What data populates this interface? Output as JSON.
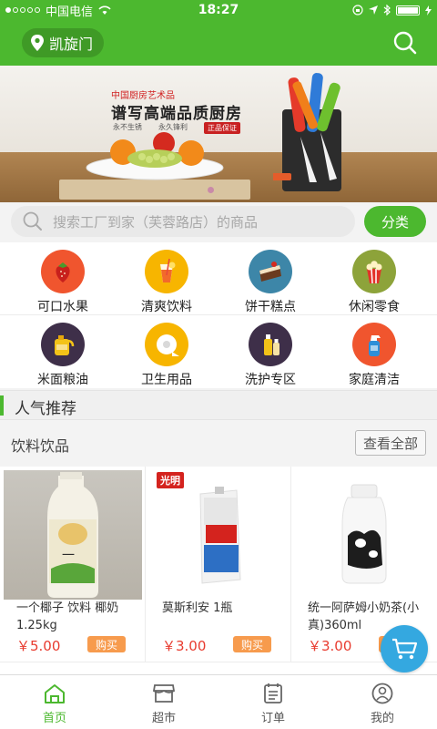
{
  "status_bar": {
    "carrier": "中国电信",
    "time": "18:27"
  },
  "header": {
    "location": "凯旋门"
  },
  "banner": {
    "subtitle": "中国厨房艺术品",
    "title": "谱写高端品质厨房",
    "tag1": "永不生锈",
    "tag2": "永久锋利",
    "badge": "正品保证"
  },
  "search": {
    "placeholder": "搜索工厂到家（芙蓉路店）的商品",
    "category_label": "分类"
  },
  "categories": [
    {
      "label": "可口水果",
      "color": "#f0552e",
      "icon": "strawberry-icon"
    },
    {
      "label": "清爽饮料",
      "color": "#f7b500",
      "icon": "drink-icon"
    },
    {
      "label": "饼干糕点",
      "color": "#3d86a8",
      "icon": "cake-icon"
    },
    {
      "label": "休闲零食",
      "color": "#8da33a",
      "icon": "popcorn-icon"
    },
    {
      "label": "米面粮油",
      "color": "#3e2f49",
      "icon": "oil-icon"
    },
    {
      "label": "卫生用品",
      "color": "#f7b500",
      "icon": "tissue-icon"
    },
    {
      "label": "洗护专区",
      "color": "#3e2f49",
      "icon": "lotion-icon"
    },
    {
      "label": "家庭清洁",
      "color": "#f0552e",
      "icon": "cleaner-icon"
    }
  ],
  "popular": {
    "title": "人气推荐"
  },
  "section": {
    "title": "饮料饮品",
    "view_all": "查看全部"
  },
  "products": [
    {
      "name": "一个椰子 饮料 椰奶 1.25kg",
      "price": "￥5.00",
      "buy": "购买"
    },
    {
      "name": "莫斯利安 1瓶",
      "price": "￥3.00",
      "buy": "购买",
      "brand": "光明"
    },
    {
      "name": "统一阿萨姆小奶茶(小真)360ml",
      "price": "￥3.00",
      "buy": "购买"
    }
  ],
  "nav": [
    {
      "label": "首页",
      "icon": "home-icon",
      "active": true
    },
    {
      "label": "超市",
      "icon": "store-icon",
      "active": false
    },
    {
      "label": "订单",
      "icon": "order-icon",
      "active": false
    },
    {
      "label": "我的",
      "icon": "user-icon",
      "active": false
    }
  ],
  "colors": {
    "primary": "#4cb82f",
    "price": "#e83b2f",
    "buy": "#f79b4d",
    "cart": "#34a8e0"
  }
}
